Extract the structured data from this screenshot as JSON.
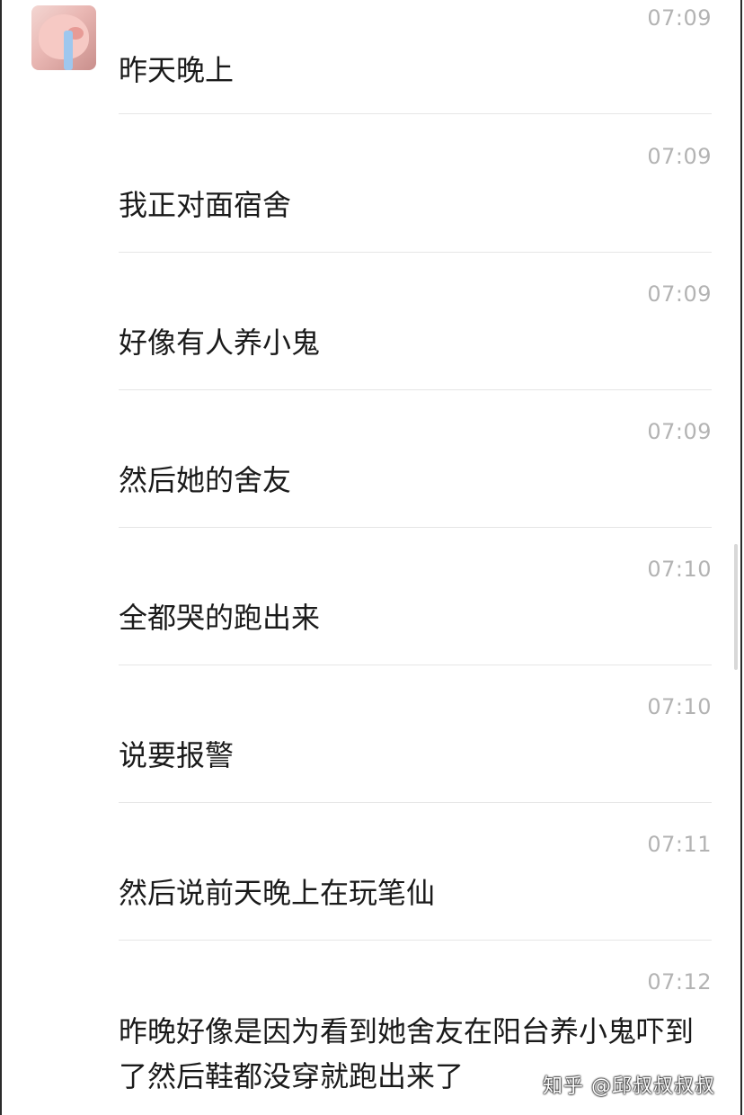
{
  "messages": [
    {
      "time": "07:09",
      "text": "昨天晚上"
    },
    {
      "time": "07:09",
      "text": "我正对面宿舍"
    },
    {
      "time": "07:09",
      "text": "好像有人养小鬼"
    },
    {
      "time": "07:09",
      "text": "然后她的舍友"
    },
    {
      "time": "07:10",
      "text": "全都哭的跑出来"
    },
    {
      "time": "07:10",
      "text": "说要报警"
    },
    {
      "time": "07:11",
      "text": "然后说前天晚上在玩笔仙"
    },
    {
      "time": "07:12",
      "text": "昨晚好像是因为看到她舍友在阳台养小鬼吓到了然后鞋都没穿就跑出来了"
    }
  ],
  "watermark": "知乎 @邱叔叔叔叔"
}
